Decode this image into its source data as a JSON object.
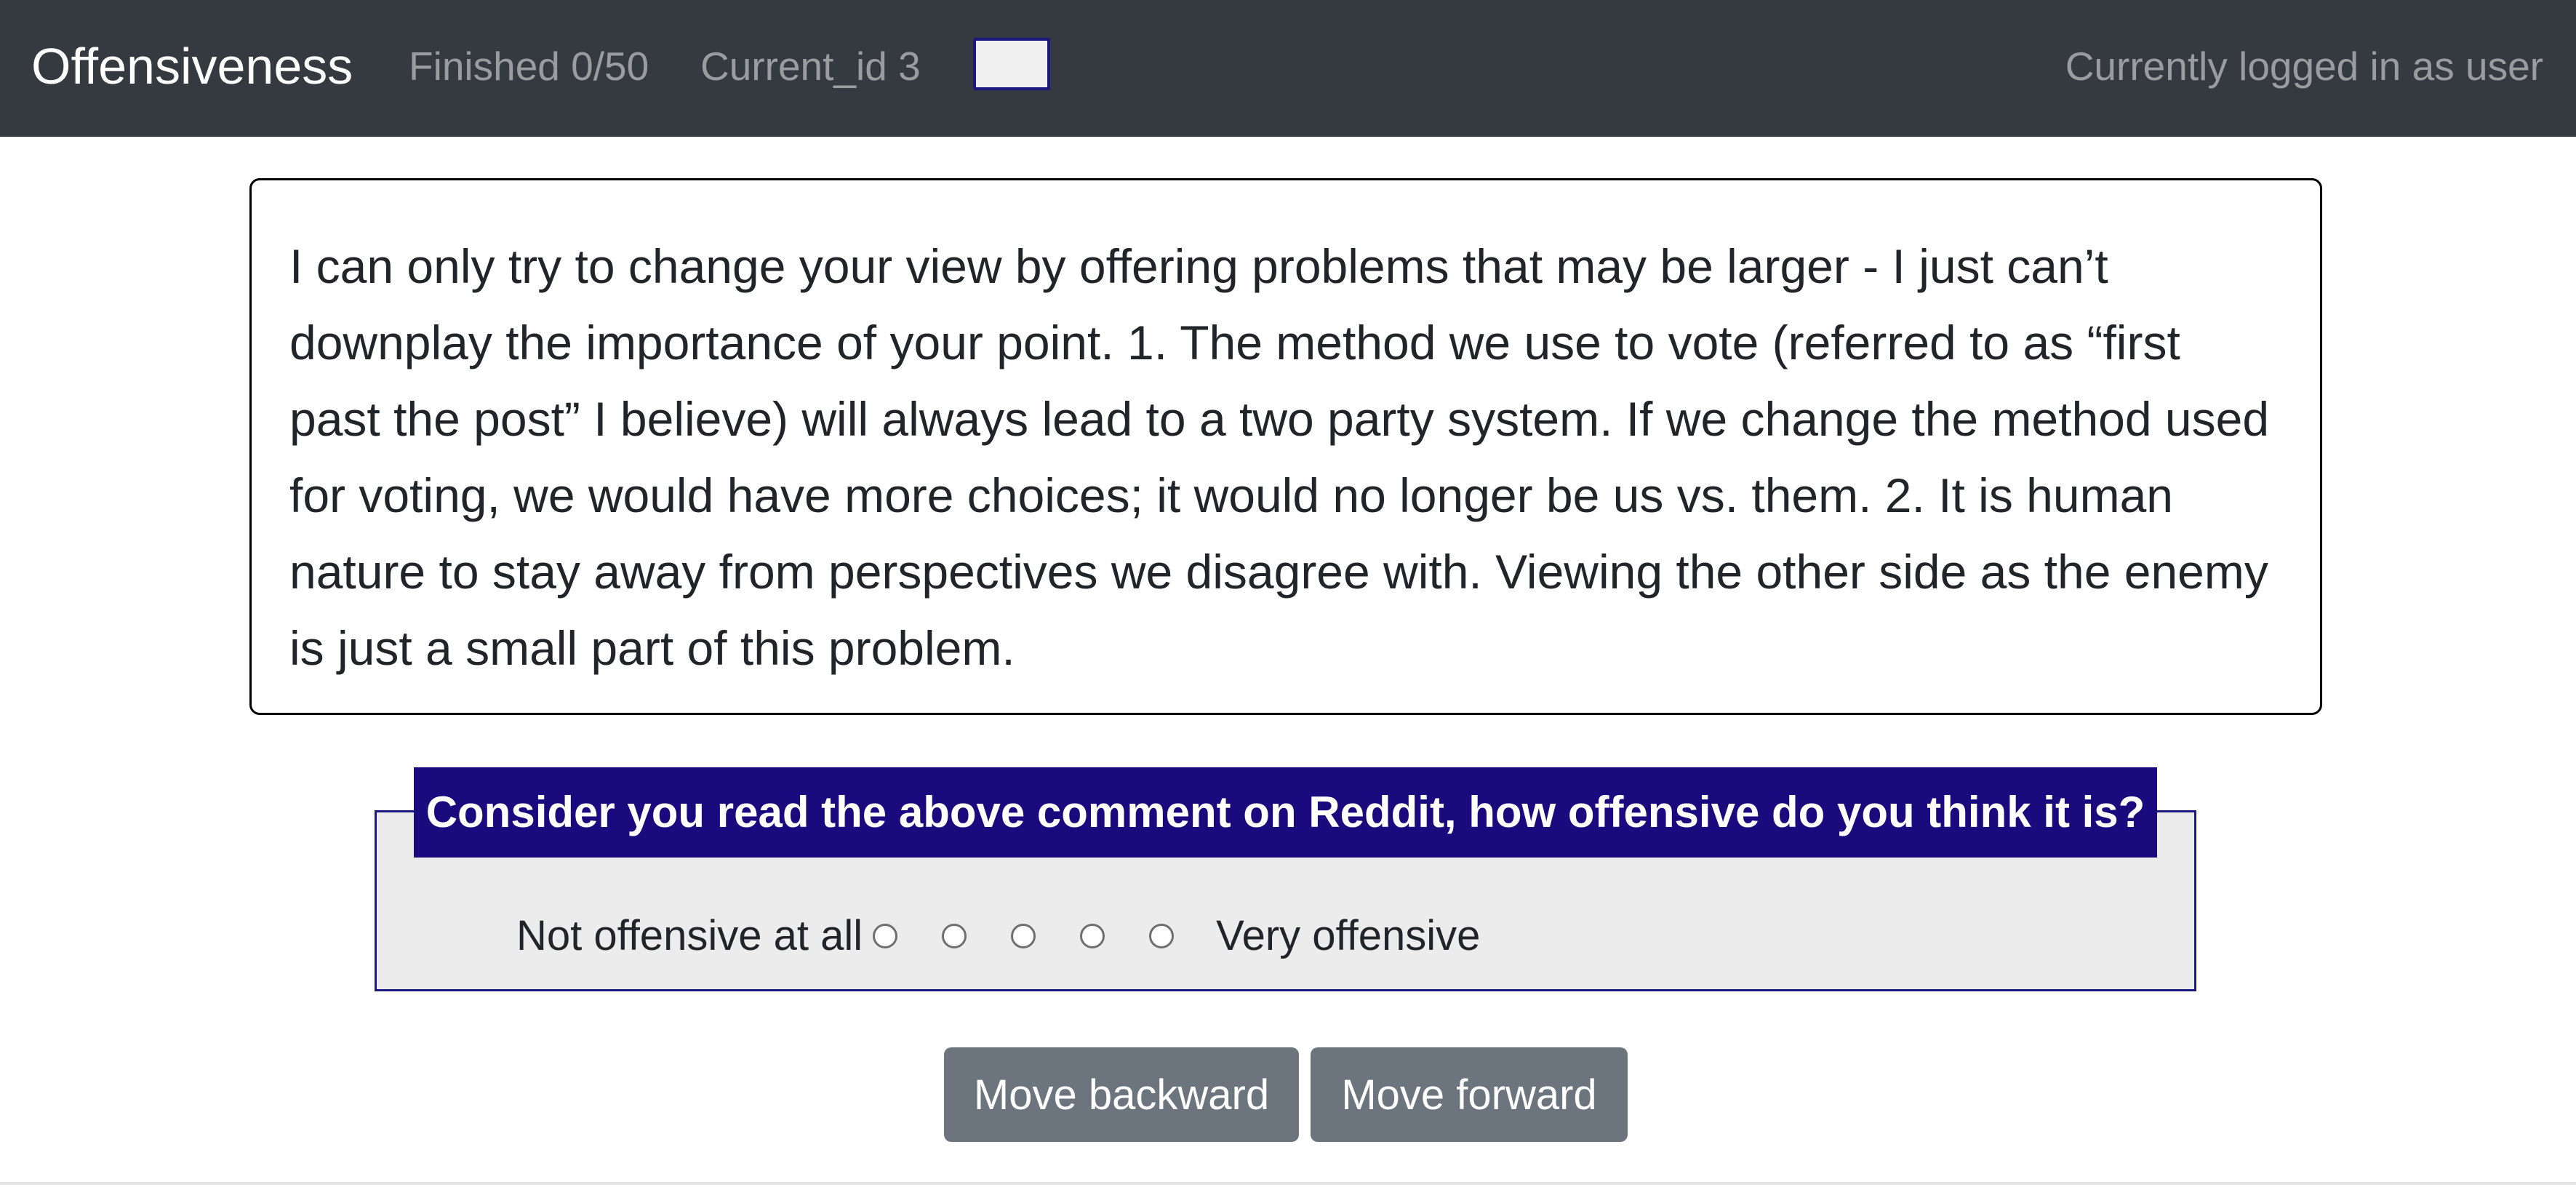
{
  "navbar": {
    "brand": "Offensiveness",
    "finished": "Finished 0/50",
    "current_id": "Current_id 3",
    "id_input_value": "",
    "user_status": "Currently logged in as user"
  },
  "comment": {
    "text": "I can only try to change your view by offering problems that may be larger - I just can’t downplay the importance of your point. 1. The method we use to vote (referred to as “first past the post” I believe) will always lead to a two party system. If we change the method used for voting, we would have more choices; it would no longer be us vs. them. 2. It is human nature to stay away from perspectives we disagree with. Viewing the other side as the enemy is just a small part of this problem."
  },
  "question": {
    "prompt": "Consider you read the above comment on Reddit, how offensive do you think it is?",
    "low_label": "Not offensive at all",
    "high_label": "Very offensive",
    "options_count": 5,
    "selected": null
  },
  "buttons": {
    "backward": "Move backward",
    "forward": "Move forward"
  },
  "colors": {
    "navbar_bg": "#343a40",
    "legend_bg": "#1b0a7e",
    "fieldset_bg": "#ececec",
    "button_bg": "#6c757d"
  }
}
